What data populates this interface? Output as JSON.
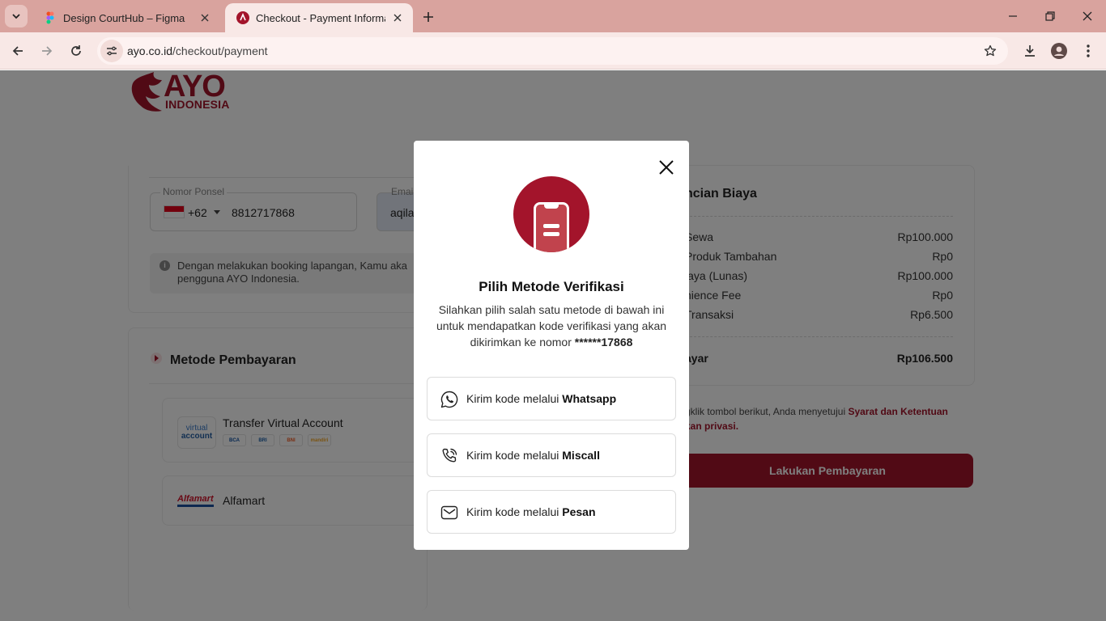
{
  "browser": {
    "tabs": [
      {
        "title": "Design CourtHub – Figma",
        "active": false
      },
      {
        "title": "Checkout - Payment Informatio",
        "active": true
      }
    ],
    "url_host": "ayo.co.id",
    "url_path": "/checkout/payment"
  },
  "brand": {
    "name": "AYO",
    "sub": "INDONESIA",
    "color": "#a3142b"
  },
  "contact": {
    "phone_label": "Nomor Ponsel",
    "country_code": "+62",
    "phone_value": "8812717868",
    "email_label": "Email",
    "email_value": "aqila",
    "notice_line1": "Dengan melakukan booking lapangan, Kamu aka",
    "notice_line2": "pengguna AYO Indonesia."
  },
  "payment_methods": {
    "title": "Metode Pembayaran",
    "va_logo_line1": "virtual",
    "va_logo_line2": "account",
    "va_name": "Transfer Virtual Account",
    "banks": [
      "BCA",
      "BRI",
      "BNI",
      "mandiri"
    ],
    "alfamart_logo": "Alfamart",
    "alfamart_name": "Alfamart"
  },
  "summary": {
    "title": "ncian Biaya",
    "rows": [
      {
        "label": "Sewa",
        "value": "Rp100.000"
      },
      {
        "label": "Produk Tambahan",
        "value": "Rp0"
      },
      {
        "label": "iaya (Lunas)",
        "value": "Rp100.000"
      },
      {
        "label": "nience Fee",
        "value": "Rp0"
      },
      {
        "label": "Transaksi",
        "value": "Rp6.500"
      }
    ],
    "total_label": "ayar",
    "total_value": "Rp106.500"
  },
  "terms": {
    "line1_text": "gklik tombol berikut, Anda menyetujui ",
    "line1_link": "Syarat dan Ketentuan",
    "line2_link": "kan privasi."
  },
  "pay_button": "Lakukan Pembayaran",
  "modal": {
    "title": "Pilih Metode Verifikasi",
    "description": "Silahkan pilih salah satu metode di bawah ini untuk mendapatkan kode verifikasi yang akan dikirimkan ke nomor ",
    "masked_number": "******17868",
    "option_prefix": "Kirim kode melalui ",
    "options": [
      {
        "channel": "Whatsapp",
        "icon": "whatsapp-icon"
      },
      {
        "channel": "Miscall",
        "icon": "phone-call-icon"
      },
      {
        "channel": "Pesan",
        "icon": "envelope-icon"
      }
    ]
  }
}
